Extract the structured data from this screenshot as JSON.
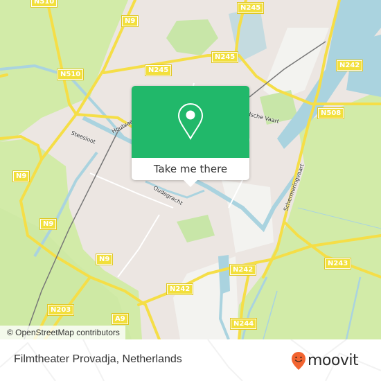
{
  "map": {
    "colors": {
      "urban": "#ece6e2",
      "farmland": "#d2eba8",
      "park": "#c8e6a8",
      "water": "#aad3df",
      "road_major": "#f5de47",
      "road_minor": "#ffffff",
      "rail": "#777777",
      "light_area": "#f3f3f0"
    },
    "road_shields": [
      {
        "id": "n510-top",
        "label": "N510"
      },
      {
        "id": "n9-top",
        "label": "N9"
      },
      {
        "id": "n245-top",
        "label": "N245"
      },
      {
        "id": "n510-left",
        "label": "N510"
      },
      {
        "id": "n245-mid",
        "label": "N245"
      },
      {
        "id": "n245-left",
        "label": "N245"
      },
      {
        "id": "n242-top-right",
        "label": "N242"
      },
      {
        "id": "n508",
        "label": "N508"
      },
      {
        "id": "n9-left",
        "label": "N9"
      },
      {
        "id": "n9-lower-left",
        "label": "N9"
      },
      {
        "id": "n9-bottom",
        "label": "N9"
      },
      {
        "id": "n242-bottom-right",
        "label": "N242"
      },
      {
        "id": "n243",
        "label": "N243"
      },
      {
        "id": "n242-bottom",
        "label": "N242"
      },
      {
        "id": "a9",
        "label": "A9"
      },
      {
        "id": "n203",
        "label": "N203"
      },
      {
        "id": "n244",
        "label": "N244"
      }
    ],
    "street_labels": [
      {
        "id": "steesloot",
        "label": "Steesloot"
      },
      {
        "id": "houtvaart",
        "label": "Houtvaart"
      },
      {
        "id": "oudegracht",
        "label": "Oudegracht"
      },
      {
        "id": "schermeringvaart",
        "label": "Schermeringvaart"
      },
      {
        "id": "noordhollandsch",
        "label": "Noordhollandsche Vaart"
      }
    ],
    "attribution": "© OpenStreetMap contributors"
  },
  "popup": {
    "icon": "location-pin-icon",
    "button_label": "Take me there",
    "accent_color": "#21b86a"
  },
  "footer": {
    "place_name": "Filmtheater Provadja, Netherlands",
    "brand": {
      "name": "moovit",
      "icon": "moovit-smiley-pin-icon",
      "icon_color": "#f26430"
    }
  }
}
